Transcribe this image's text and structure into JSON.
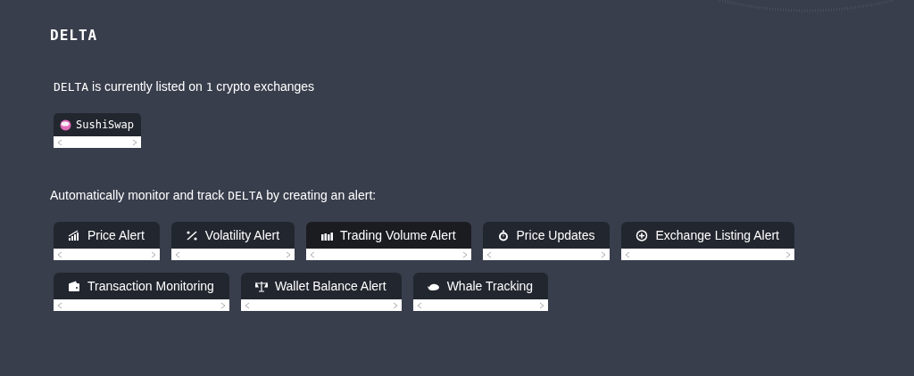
{
  "title": "DELTA",
  "listing": {
    "symbol": "DELTA",
    "middle": " is currently listed on ",
    "count": "1",
    "after": " crypto exchanges"
  },
  "exchanges": [
    {
      "name": "SushiSwap"
    }
  ],
  "alert_intro": {
    "before": "Automatically monitor and track ",
    "symbol": "DELTA",
    "after": " by creating an alert:"
  },
  "alert_rows": [
    [
      {
        "label": "Price Alert",
        "selected": false
      },
      {
        "label": "Volatility Alert",
        "selected": false
      },
      {
        "label": "Trading Volume Alert",
        "selected": true
      },
      {
        "label": "Price Updates",
        "selected": false
      },
      {
        "label": "Exchange Listing Alert",
        "selected": false
      }
    ],
    [
      {
        "label": "Transaction Monitoring",
        "selected": false
      },
      {
        "label": "Wallet Balance Alert",
        "selected": false
      },
      {
        "label": "Whale Tracking",
        "selected": false
      }
    ]
  ]
}
